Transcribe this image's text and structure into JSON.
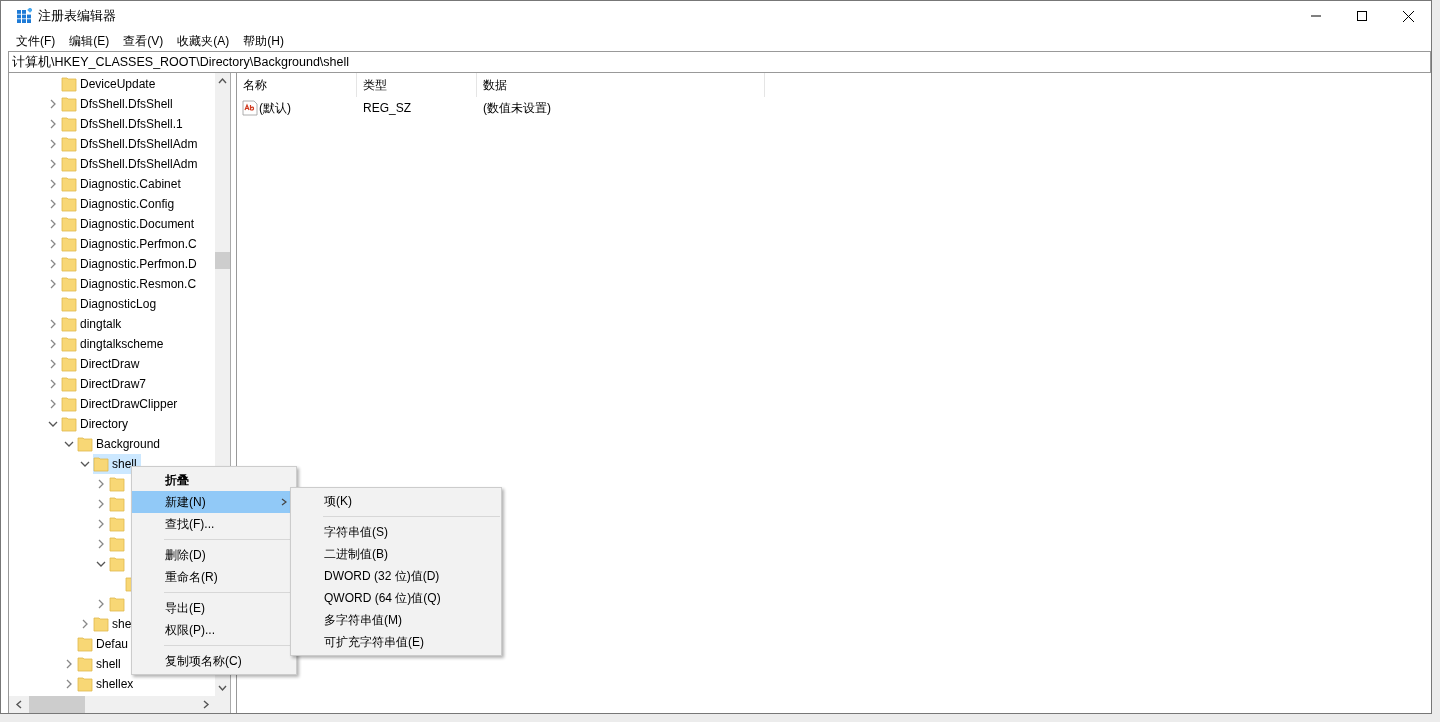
{
  "window": {
    "title": "注册表编辑器"
  },
  "menu_bar": [
    "文件(F)",
    "编辑(E)",
    "查看(V)",
    "收藏夹(A)",
    "帮助(H)"
  ],
  "address": "计算机\\HKEY_CLASSES_ROOT\\Directory\\Background\\shell",
  "tree": [
    {
      "label": "DeviceUpdate",
      "selected": false
    },
    {
      "label": "DfsShell.DfsShell",
      "expanded": false,
      "selected": false
    },
    {
      "label": "DfsShell.DfsShell.1",
      "expanded": false,
      "selected": false
    },
    {
      "label": "DfsShell.DfsShellAdm",
      "expanded": false,
      "selected": false
    },
    {
      "label": "DfsShell.DfsShellAdm",
      "expanded": false,
      "selected": false
    },
    {
      "label": "Diagnostic.Cabinet",
      "expanded": false,
      "selected": false
    },
    {
      "label": "Diagnostic.Config",
      "expanded": false,
      "selected": false
    },
    {
      "label": "Diagnostic.Document",
      "expanded": false,
      "selected": false
    },
    {
      "label": "Diagnostic.Perfmon.C",
      "expanded": false,
      "selected": false
    },
    {
      "label": "Diagnostic.Perfmon.D",
      "expanded": false,
      "selected": false
    },
    {
      "label": "Diagnostic.Resmon.C",
      "expanded": false,
      "selected": false
    },
    {
      "label": "DiagnosticLog",
      "selected": false
    },
    {
      "label": "dingtalk",
      "expanded": false,
      "selected": false
    },
    {
      "label": "dingtalkscheme",
      "expanded": false,
      "selected": false
    },
    {
      "label": "DirectDraw",
      "expanded": false,
      "selected": false
    },
    {
      "label": "DirectDraw7",
      "expanded": false,
      "selected": false
    },
    {
      "label": "DirectDrawClipper",
      "expanded": false,
      "selected": false
    },
    {
      "label": "Directory",
      "expanded": true,
      "selected": false,
      "children": [
        {
          "label": "Background",
          "expanded": true,
          "selected": false,
          "children": [
            {
              "label": "shell",
              "expanded": true,
              "selected": true,
              "children": [
                {
                  "expanded": false,
                  "selected": false
                },
                {
                  "expanded": false,
                  "selected": false
                },
                {
                  "expanded": false,
                  "selected": false
                },
                {
                  "expanded": false,
                  "selected": false
                },
                {
                  "expanded": true,
                  "selected": false,
                  "children": [
                    {
                      "selected": false
                    }
                  ]
                },
                {
                  "expanded": false,
                  "selected": false
                }
              ]
            },
            {
              "label": "she",
              "expanded": false,
              "selected": false
            }
          ]
        },
        {
          "label": "Defau",
          "selected": false
        },
        {
          "label": "shell",
          "expanded": false,
          "selected": false
        },
        {
          "label": "shellex",
          "expanded": false,
          "selected": false
        }
      ]
    }
  ],
  "values_table": {
    "columns": [
      "名称",
      "类型",
      "数据"
    ],
    "rows": [
      {
        "name": "(默认)",
        "type": "REG_SZ",
        "data": "(数值未设置)"
      }
    ]
  },
  "context_menu": [
    {
      "label": "折叠",
      "kind": "default",
      "selected": false,
      "has_submenu": false
    },
    {
      "label": "新建(N)",
      "kind": "item",
      "selected": true,
      "has_submenu": true
    },
    {
      "label": "查找(F)...",
      "kind": "item",
      "selected": false,
      "has_submenu": false
    },
    {
      "kind": "separator"
    },
    {
      "label": "删除(D)",
      "kind": "item",
      "selected": false,
      "has_submenu": false
    },
    {
      "label": "重命名(R)",
      "kind": "item",
      "selected": false,
      "has_submenu": false
    },
    {
      "kind": "separator"
    },
    {
      "label": "导出(E)",
      "kind": "item",
      "selected": false,
      "has_submenu": false
    },
    {
      "label": "权限(P)...",
      "kind": "item",
      "selected": false,
      "has_submenu": false
    },
    {
      "kind": "separator"
    },
    {
      "label": "复制项名称(C)",
      "kind": "item",
      "selected": false,
      "has_submenu": false
    }
  ],
  "submenu": [
    {
      "label": "项(K)",
      "kind": "item",
      "selected": false
    },
    {
      "kind": "separator"
    },
    {
      "label": "字符串值(S)",
      "kind": "item",
      "selected": false
    },
    {
      "label": "二进制值(B)",
      "kind": "item",
      "selected": false
    },
    {
      "label": "DWORD (32 位)值(D)",
      "kind": "item",
      "selected": false
    },
    {
      "label": "QWORD (64 位)值(Q)",
      "kind": "item",
      "selected": false
    },
    {
      "label": "多字符串值(M)",
      "kind": "item",
      "selected": false
    },
    {
      "label": "可扩充字符串值(E)",
      "kind": "item",
      "selected": false
    }
  ]
}
